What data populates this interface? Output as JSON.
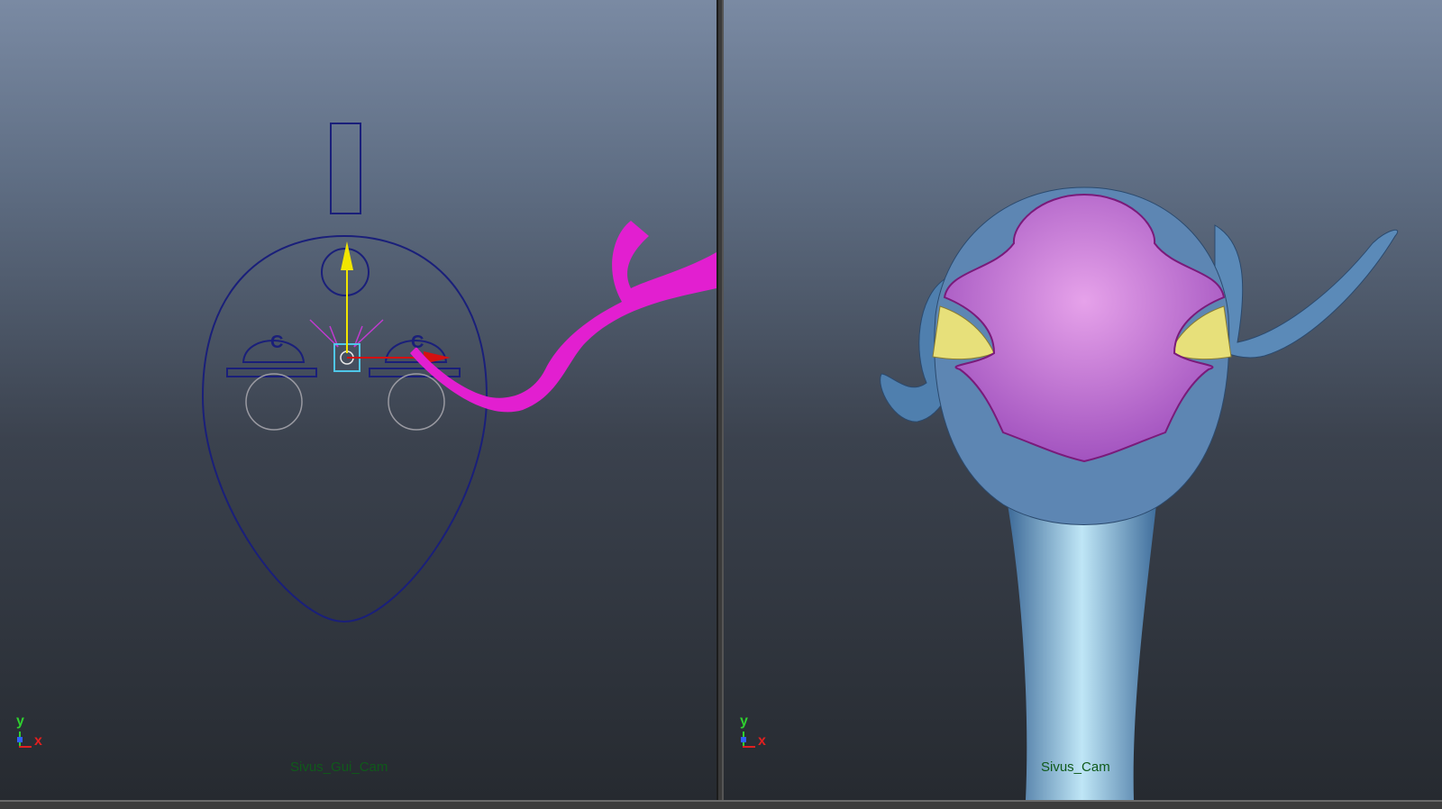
{
  "viewports": {
    "left": {
      "camera_label": "Sivus_Gui_Cam",
      "axis": {
        "y": "y",
        "x": "x"
      }
    },
    "right": {
      "camera_label": "Sivus_Cam",
      "axis": {
        "y": "y",
        "x": "x"
      }
    }
  },
  "gui_controls": {
    "left_eye_letter": "C",
    "right_eye_letter": "C"
  },
  "colors": {
    "control_curve": "#1a1f7a",
    "selection": "#e21fd0",
    "manip_y": "#f2e600",
    "manip_x": "#d41111",
    "skin": "#5d86b3",
    "mask": "#b86ad0",
    "eye": "#e7e07a",
    "label_green": "#0f5a1a"
  }
}
